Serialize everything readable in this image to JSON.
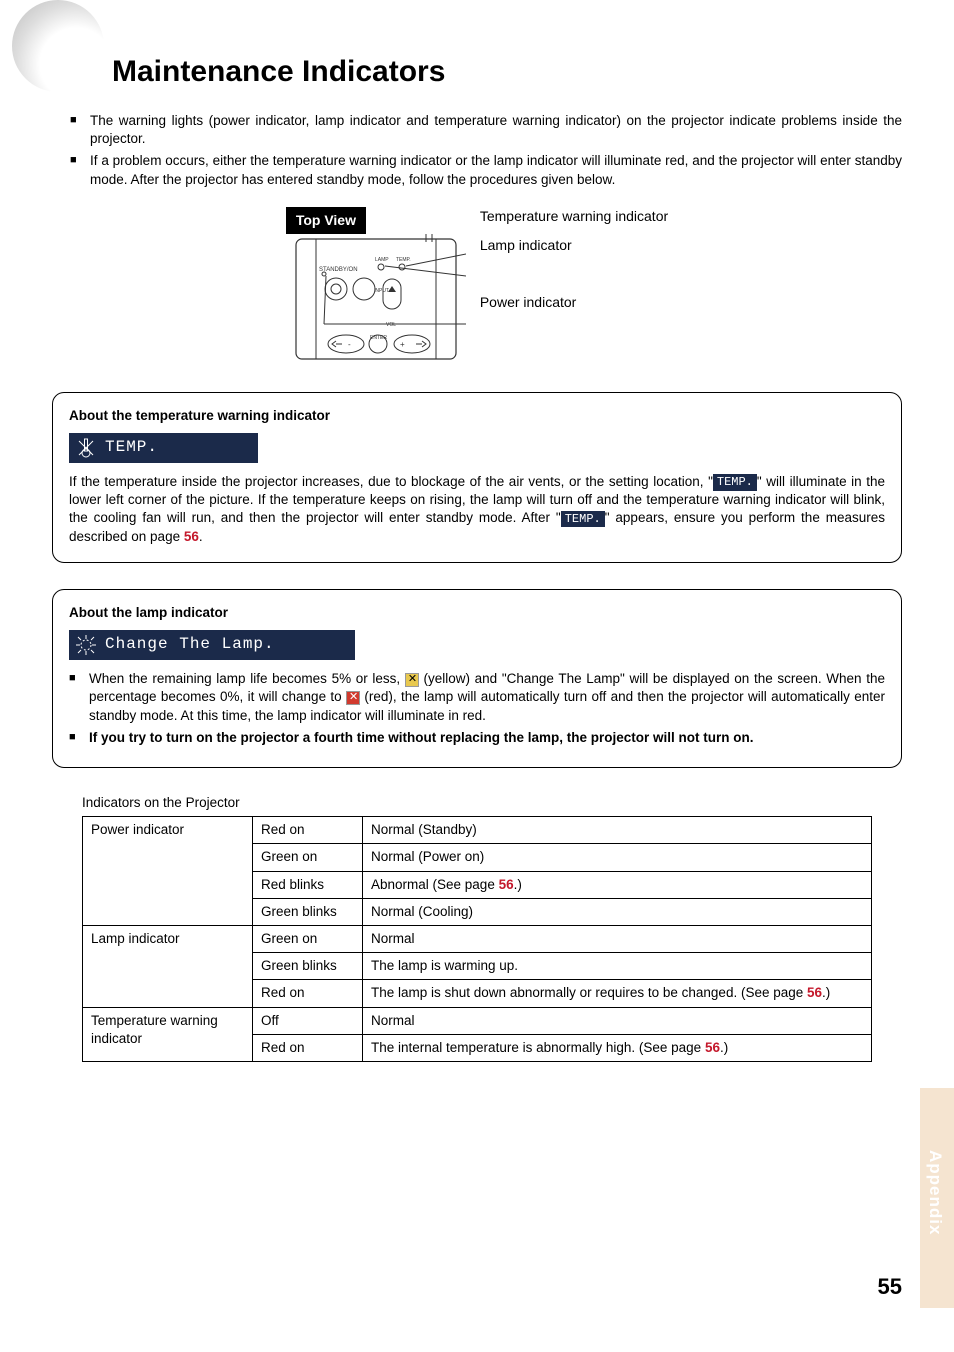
{
  "title": "Maintenance Indicators",
  "intro": [
    "The warning lights (power indicator, lamp indicator and temperature warning indicator) on the projector indicate problems inside the projector.",
    "If a problem occurs, either the temperature warning indicator or the lamp indicator will illuminate red, and the projector will enter standby mode. After the projector has entered standby mode, follow the procedures given below."
  ],
  "top_view": {
    "badge": "Top View",
    "labels": {
      "temp": "Temperature warning indicator",
      "lamp": "Lamp indicator",
      "power": "Power indicator"
    }
  },
  "temp_box": {
    "head": "About the temperature warning indicator",
    "tag": "TEMP.",
    "p1a": "If the temperature inside the projector increases, due to blockage of the air vents, or the setting location, \"",
    "temp_inline": "TEMP.",
    "p1b": "\" will illuminate in the lower left corner of the picture. If the temperature keeps on rising, the lamp will turn off and the temperature warning indicator will blink, the cooling fan will run, and then the projector will enter standby mode. After \"",
    "p1c": "\" appears, ensure you perform the measures described on page ",
    "page_ref": "56",
    "p1d": "."
  },
  "lamp_box": {
    "head": "About the lamp indicator",
    "tag": "Change The Lamp.",
    "item1a": "When the remaining lamp life becomes 5% or less, ",
    "item1b": " (yellow) and \"Change The Lamp\" will be displayed on the screen. When the percentage becomes 0%, it will change to ",
    "item1c": " (red), the lamp will automatically turn off and then the projector will automatically enter standby mode. At this time, the lamp indicator will illuminate in red.",
    "item2": "If you try to turn on the projector a fourth time without replacing the lamp, the projector will not turn on."
  },
  "table": {
    "title": "Indicators on the Projector",
    "rows": [
      {
        "ind": "Power indicator",
        "indspan": 4,
        "state": "Red on",
        "desc": "Normal (Standby)"
      },
      {
        "state": "Green on",
        "desc": "Normal (Power on)"
      },
      {
        "state": "Red blinks",
        "desc_pre": "Abnormal (See page ",
        "desc_ref": "56",
        "desc_post": ".)"
      },
      {
        "state": "Green blinks",
        "desc": "Normal (Cooling)"
      },
      {
        "ind": "Lamp indicator",
        "indspan": 3,
        "state": "Green on",
        "desc": "Normal"
      },
      {
        "state": "Green blinks",
        "desc": "The lamp is warming up."
      },
      {
        "state": "Red on",
        "desc_pre": "The lamp is shut down abnormally or requires to be changed. (See page ",
        "desc_ref": "56",
        "desc_post": ".)"
      },
      {
        "ind": "Temperature warning indicator",
        "indspan": 2,
        "state": "Off",
        "desc": "Normal"
      },
      {
        "state": "Red on",
        "desc_pre": "The internal temperature is abnormally high. (See page ",
        "desc_ref": "56",
        "desc_post": ".)"
      }
    ]
  },
  "side_tab": "Appendix",
  "page_number": "55"
}
